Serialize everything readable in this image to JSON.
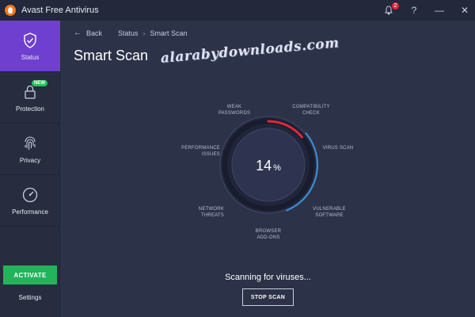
{
  "window": {
    "title": "Avast Free Antivirus",
    "notification_count": "2",
    "icons": [
      "bell-icon",
      "help-icon",
      "minimize-icon",
      "close-icon"
    ]
  },
  "sidebar": {
    "items": [
      {
        "label": "Status",
        "icon": "shield-check-icon",
        "active": true
      },
      {
        "label": "Protection",
        "icon": "lock-icon",
        "badge": "NEW"
      },
      {
        "label": "Privacy",
        "icon": "fingerprint-icon"
      },
      {
        "label": "Performance",
        "icon": "speedometer-icon"
      }
    ],
    "activate_label": "ACTIVATE",
    "settings_label": "Settings"
  },
  "main": {
    "breadcrumb": {
      "back": "Back",
      "parent": "Status",
      "current": "Smart Scan"
    },
    "title": "Smart Scan",
    "watermark": "alarabydownloads.com",
    "scan": {
      "progress": 14,
      "percent_value": "14",
      "percent_sign": "%",
      "categories": {
        "weak_passwords": [
          "WEAK",
          "PASSWORDS"
        ],
        "compatibility_check": [
          "COMPATIBILITY",
          "CHECK"
        ],
        "virus_scan": [
          "VIRUS SCAN"
        ],
        "performance_issues": [
          "PERFORMANCE",
          "ISSUES"
        ],
        "network_threats": [
          "NETWORK",
          "THREATS"
        ],
        "vulnerable_software": [
          "VULNERABLE",
          "SOFTWARE"
        ],
        "browser_addons": [
          "BROWSER",
          "ADD-ONS"
        ]
      },
      "status_text": "Scanning for viruses...",
      "stop_label": "STOP SCAN"
    }
  },
  "colors": {
    "accent_purple": "#6f3fd0",
    "activate_green": "#23b35a",
    "progress_red": "#e3263a",
    "ring_blue": "#3b8fd6",
    "background": "#2c3247"
  }
}
